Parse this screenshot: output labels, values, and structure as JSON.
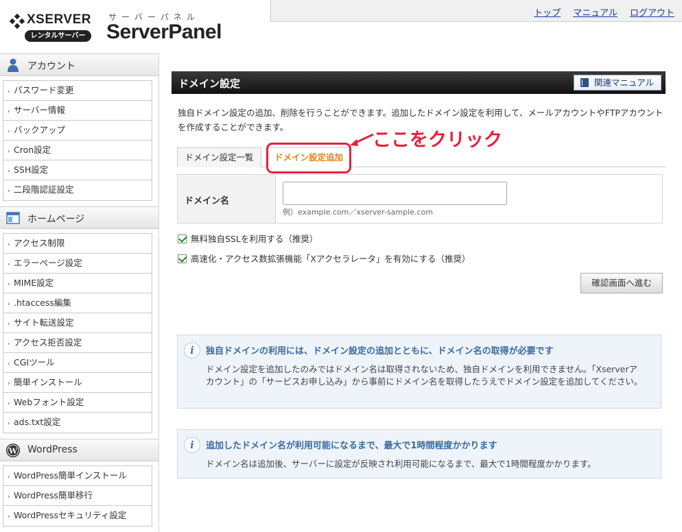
{
  "header": {
    "logo_text": "XSERVER",
    "logo_badge": "レンタルサーバー",
    "panel_sub": "サーバーパネル",
    "panel_title": "ServerPanel",
    "nav": {
      "top": "トップ",
      "manual": "マニュアル",
      "logout": "ログアウト"
    }
  },
  "sidebar": {
    "sections": [
      {
        "title": "アカウント",
        "icon": "user-icon",
        "items": [
          "パスワード変更",
          "サーバー情報",
          "バックアップ",
          "Cron設定",
          "SSH設定",
          "二段階認証設定"
        ]
      },
      {
        "title": "ホームページ",
        "icon": "homepage-icon",
        "items": [
          "アクセス制限",
          "エラーページ設定",
          "MIME設定",
          ".htaccess編集",
          "サイト転送設定",
          "アクセス拒否設定",
          "CGIツール",
          "簡単インストール",
          "Webフォント設定",
          "ads.txt設定"
        ]
      },
      {
        "title": "WordPress",
        "icon": "wordpress-icon",
        "items": [
          "WordPress簡単インストール",
          "WordPress簡単移行",
          "WordPressセキュリティ設定"
        ]
      }
    ]
  },
  "main": {
    "title": "ドメイン設定",
    "manual_button": "関連マニュアル",
    "intro": "独自ドメイン設定の追加、削除を行うことができます。追加したドメイン設定を利用して、メールアカウントやFTPアカウントを作成することができます。",
    "annotation": "ここをクリック",
    "tabs": [
      {
        "label": "ドメイン設定一覧",
        "active": false
      },
      {
        "label": "ドメイン設定追加",
        "active": true
      }
    ],
    "form": {
      "domain_label": "ドメイン名",
      "domain_value": "",
      "domain_example": "例）example.com／xserver-sample.com",
      "ssl_checkbox": "無料独自SSLを利用する（推奨）",
      "accel_checkbox": "高速化・アクセス数拡張機能「Xアクセラレータ」を有効にする（推奨）",
      "confirm_button": "確認画面へ進む"
    },
    "info_boxes": [
      {
        "title": "独自ドメインの利用には、ドメイン設定の追加とともに、ドメイン名の取得が必要です",
        "body": "ドメイン設定を追加したのみではドメイン名は取得されないため、独自ドメインを利用できません。「Xserverアカウント」の「サービスお申し込み」から事前にドメイン名を取得したうえでドメイン設定を追加してください。"
      },
      {
        "title": "追加したドメイン名が利用可能になるまで、最大で1時間程度かかります",
        "body": "ドメイン名は追加後、サーバーに設定が反映され利用可能になるまで、最大で1時間程度かかります。"
      }
    ]
  },
  "colors": {
    "annotation_red": "#e5213d",
    "active_tab_orange": "#e08419",
    "link_blue": "#1a3a9c",
    "check_green": "#1f8a1f"
  }
}
